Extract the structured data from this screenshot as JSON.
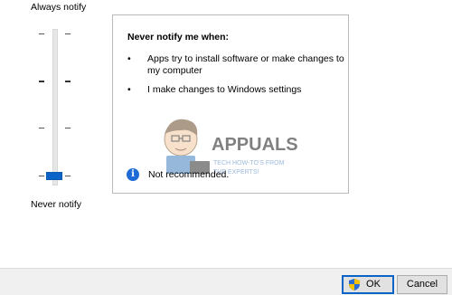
{
  "slider": {
    "top_label": "Always notify",
    "bottom_label": "Never notify",
    "level": 0,
    "levels": 4
  },
  "panel": {
    "heading": "Never notify me when:",
    "bullets": [
      "Apps try to install software or make changes to my computer",
      "I make changes to Windows settings"
    ],
    "info_icon": "info-icon",
    "info_text": "Not recommended."
  },
  "watermark": {
    "brand": "APPUALS",
    "tagline_1": "TECH HOW-TO'S FROM",
    "tagline_2": "THE EXPERTS!"
  },
  "buttons": {
    "ok_label": "OK",
    "cancel_label": "Cancel"
  },
  "colors": {
    "accent": "#0a64c8",
    "info": "#1e6bd6"
  }
}
